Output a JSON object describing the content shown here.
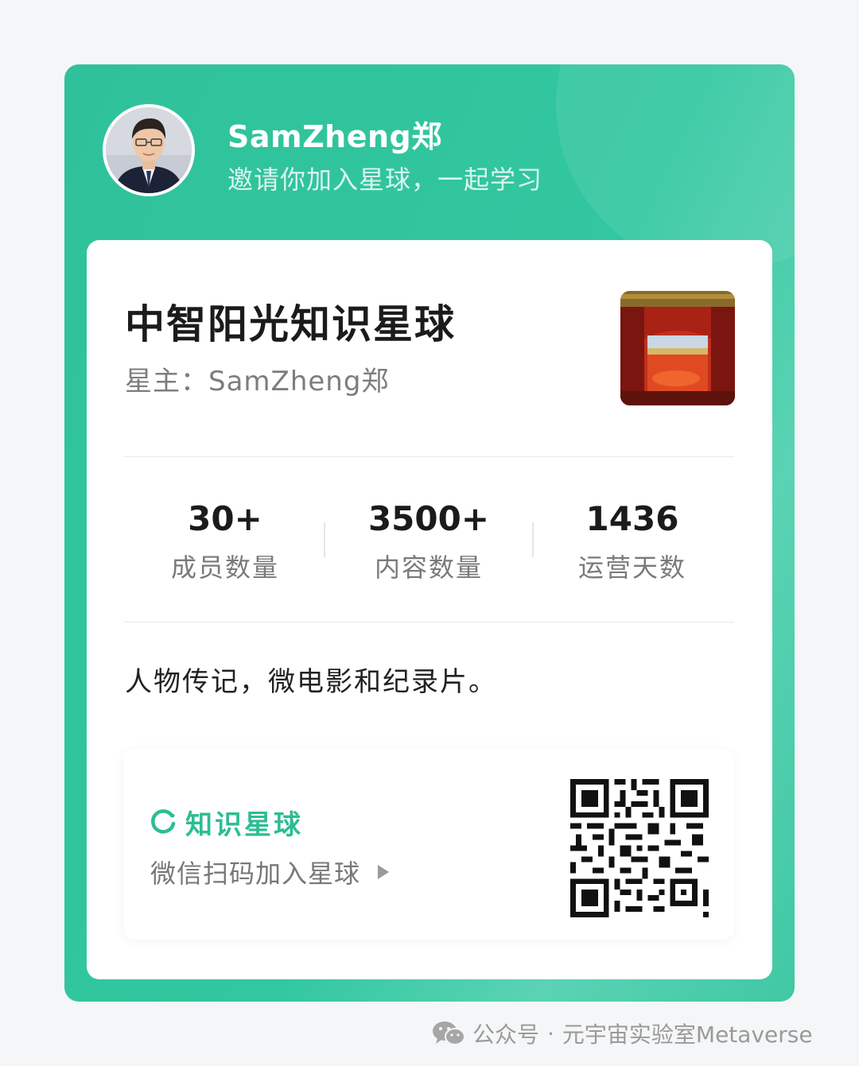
{
  "header": {
    "owner_name": "SamZheng郑",
    "invite_text": "邀请你加入星球，一起学习"
  },
  "planet": {
    "title": "中智阳光知识星球",
    "host_label": "星主：",
    "host_name": "SamZheng郑"
  },
  "stats": [
    {
      "value": "30+",
      "label": "成员数量"
    },
    {
      "value": "3500+",
      "label": "内容数量"
    },
    {
      "value": "1436",
      "label": "运营天数"
    }
  ],
  "description": "人物传记，微电影和纪录片。",
  "join": {
    "brand": "知识星球",
    "scan_text": "微信扫码加入星球",
    "icons": {
      "brand": "zsxq-logo-icon",
      "arrow": "play-arrow-icon",
      "qr": "qr-code"
    }
  },
  "footer": {
    "account_type": "公众号",
    "separator": "·",
    "account_name": "元宇宙实验室Metaverse"
  },
  "colors": {
    "brand_green": "#2dbd93",
    "card_green": "#32c7a0",
    "text_dark": "#1b1b1b",
    "text_gray": "#7a7a7a"
  }
}
